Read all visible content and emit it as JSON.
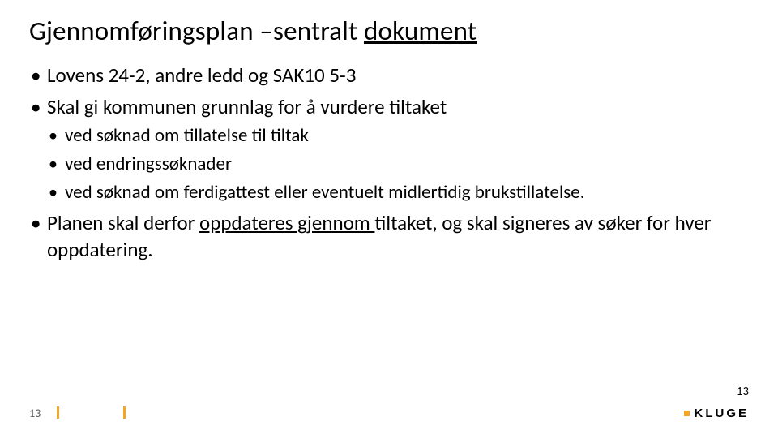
{
  "title": {
    "plain": "Gjennomføringsplan –sentralt ",
    "underlined": "dokument"
  },
  "bullets": {
    "b1": "Lovens 24-2, andre ledd og SAK10 5-3",
    "b2": "Skal gi kommunen grunnlag for å vurdere tiltaket",
    "b2_sub": {
      "s1": "ved søknad om tillatelse til tiltak",
      "s2": "ved endringssøknader",
      "s3": "ved søknad om ferdigattest eller eventuelt midlertidig brukstillatelse."
    },
    "b3_pre": "Planen skal derfor ",
    "b3_u": "oppdateres gjennom ",
    "b3_post": "tiltaket, og skal signeres av søker for hver oppdatering."
  },
  "footer": {
    "page_left": "13",
    "page_right": "13",
    "logo": "KLUGE"
  }
}
